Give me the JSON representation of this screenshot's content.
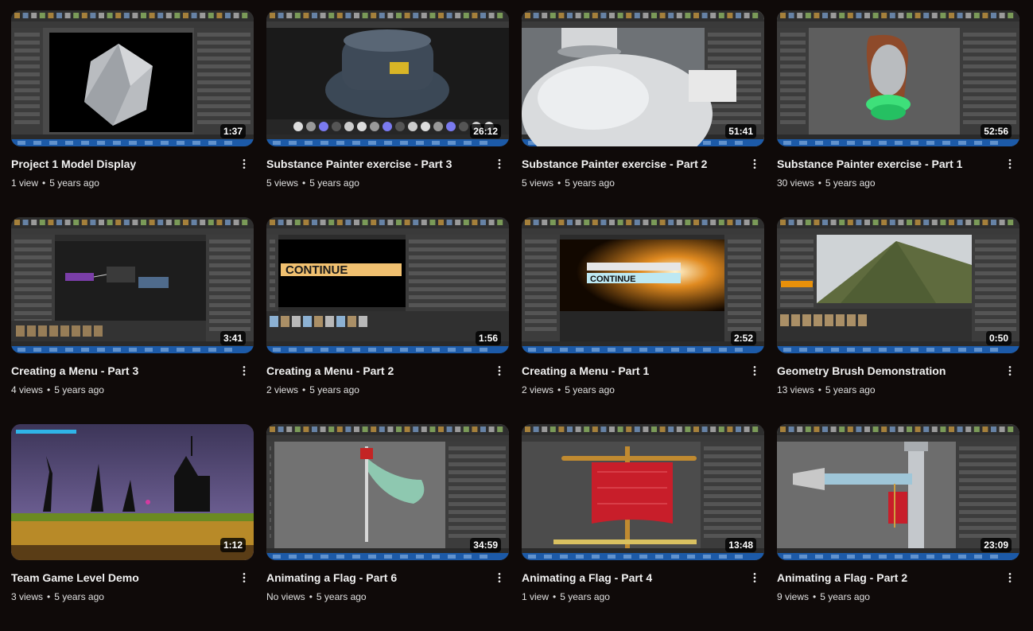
{
  "videos": [
    {
      "title": "Project 1 Model Display",
      "duration": "1:37",
      "views": "1 view",
      "age": "5 years ago",
      "thumb": "viewport-icosphere"
    },
    {
      "title": "Substance Painter exercise - Part 3",
      "duration": "26:12",
      "views": "5 views",
      "age": "5 years ago",
      "thumb": "substance-tank"
    },
    {
      "title": "Substance Painter exercise - Part 2",
      "duration": "51:41",
      "views": "5 views",
      "age": "5 years ago",
      "thumb": "white-bottle"
    },
    {
      "title": "Substance Painter exercise - Part 1",
      "duration": "52:56",
      "views": "30 views",
      "age": "5 years ago",
      "thumb": "lantern"
    },
    {
      "title": "Creating a Menu - Part 3",
      "duration": "3:41",
      "views": "4 views",
      "age": "5 years ago",
      "thumb": "blueprint-editor"
    },
    {
      "title": "Creating a Menu - Part 2",
      "duration": "1:56",
      "views": "2 views",
      "age": "5 years ago",
      "thumb": "continue-button",
      "thumb_text": "CONTINUE"
    },
    {
      "title": "Creating a Menu - Part 1",
      "duration": "2:52",
      "views": "2 views",
      "age": "5 years ago",
      "thumb": "continue-sunrise",
      "thumb_text": "CONTINUE"
    },
    {
      "title": "Geometry Brush Demonstration",
      "duration": "0:50",
      "views": "13 views",
      "age": "5 years ago",
      "thumb": "terrain"
    },
    {
      "title": "Team Game Level Demo",
      "duration": "1:12",
      "views": "3 views",
      "age": "5 years ago",
      "thumb": "platformer-level"
    },
    {
      "title": "Animating a Flag - Part 6",
      "duration": "34:59",
      "views": "No views",
      "age": "5 years ago",
      "thumb": "flag-cloth"
    },
    {
      "title": "Animating a Flag - Part 4",
      "duration": "13:48",
      "views": "1 view",
      "age": "5 years ago",
      "thumb": "red-banner"
    },
    {
      "title": "Animating a Flag - Part 2",
      "duration": "23:09",
      "views": "9 views",
      "age": "5 years ago",
      "thumb": "pipe-flag"
    }
  ],
  "icons": {
    "more": "more-vert-icon"
  }
}
